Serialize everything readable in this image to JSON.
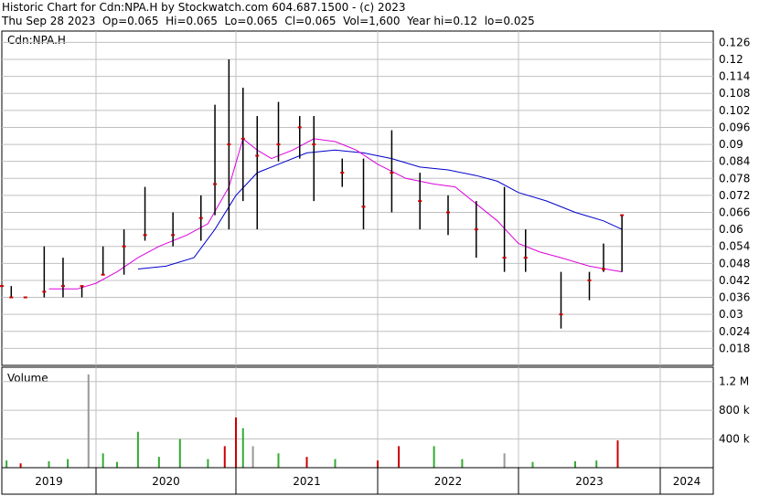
{
  "header": {
    "line1": "Historic Chart for Cdn:NPA.H by Stockwatch.com 604.687.1500 - (c) 2023",
    "line2": "Thu Sep 28 2023  Op=0.065  Hi=0.065  Lo=0.065  Cl=0.065  Vol=1,600  Year hi=0.12  lo=0.025"
  },
  "colors": {
    "price_bar": "#000000",
    "price_dot": "#cc0000",
    "ma_short": "#dd00dd",
    "ma_long": "#0000cc",
    "vol_up": "#33aa33",
    "vol_down": "#cc0000",
    "vol_neutral": "#999999",
    "grid": "#c0c0c0"
  },
  "chart_data": [
    {
      "type": "line",
      "label": "Cdn:NPA.H",
      "y_ticks": [
        "0.126",
        "0.12",
        "0.114",
        "0.108",
        "0.102",
        "0.096",
        "0.09",
        "0.084",
        "0.078",
        "0.072",
        "0.066",
        "0.06",
        "0.054",
        "0.048",
        "0.042",
        "0.036",
        "0.03",
        "0.024",
        "0.018"
      ],
      "ylim": [
        0.012,
        0.13
      ],
      "x_ticks": [
        "2019",
        "2020",
        "2021",
        "2022",
        "2023",
        "2024"
      ],
      "price_segments": [
        {
          "x": 2019.0,
          "low": 0.04,
          "high": 0.04,
          "close": 0.04
        },
        {
          "x": 2019.1,
          "low": 0.036,
          "high": 0.04,
          "close": 0.036
        },
        {
          "x": 2019.25,
          "low": 0.036,
          "high": 0.036,
          "close": 0.036
        },
        {
          "x": 2019.45,
          "low": 0.036,
          "high": 0.054,
          "close": 0.038
        },
        {
          "x": 2019.65,
          "low": 0.036,
          "high": 0.05,
          "close": 0.04
        },
        {
          "x": 2019.85,
          "low": 0.036,
          "high": 0.04,
          "close": 0.04
        },
        {
          "x": 2020.05,
          "low": 0.044,
          "high": 0.054,
          "close": 0.044
        },
        {
          "x": 2020.2,
          "low": 0.044,
          "high": 0.06,
          "close": 0.054
        },
        {
          "x": 2020.35,
          "low": 0.056,
          "high": 0.075,
          "close": 0.058
        },
        {
          "x": 2020.55,
          "low": 0.054,
          "high": 0.066,
          "close": 0.058
        },
        {
          "x": 2020.75,
          "low": 0.056,
          "high": 0.072,
          "close": 0.064
        },
        {
          "x": 2020.85,
          "low": 0.065,
          "high": 0.104,
          "close": 0.076
        },
        {
          "x": 2020.95,
          "low": 0.06,
          "high": 0.12,
          "close": 0.09
        },
        {
          "x": 2021.05,
          "low": 0.07,
          "high": 0.11,
          "close": 0.092
        },
        {
          "x": 2021.15,
          "low": 0.06,
          "high": 0.1,
          "close": 0.086
        },
        {
          "x": 2021.3,
          "low": 0.084,
          "high": 0.105,
          "close": 0.09
        },
        {
          "x": 2021.45,
          "low": 0.085,
          "high": 0.1,
          "close": 0.096
        },
        {
          "x": 2021.55,
          "low": 0.07,
          "high": 0.1,
          "close": 0.09
        },
        {
          "x": 2021.75,
          "low": 0.075,
          "high": 0.085,
          "close": 0.08
        },
        {
          "x": 2021.9,
          "low": 0.06,
          "high": 0.085,
          "close": 0.068
        },
        {
          "x": 2022.1,
          "low": 0.066,
          "high": 0.095,
          "close": 0.08
        },
        {
          "x": 2022.3,
          "low": 0.06,
          "high": 0.08,
          "close": 0.07
        },
        {
          "x": 2022.5,
          "low": 0.058,
          "high": 0.072,
          "close": 0.066
        },
        {
          "x": 2022.7,
          "low": 0.05,
          "high": 0.07,
          "close": 0.06
        },
        {
          "x": 2022.9,
          "low": 0.045,
          "high": 0.075,
          "close": 0.05
        },
        {
          "x": 2023.05,
          "low": 0.045,
          "high": 0.06,
          "close": 0.05
        },
        {
          "x": 2023.3,
          "low": 0.025,
          "high": 0.045,
          "close": 0.03
        },
        {
          "x": 2023.5,
          "low": 0.035,
          "high": 0.045,
          "close": 0.042
        },
        {
          "x": 2023.6,
          "low": 0.045,
          "high": 0.055,
          "close": 0.046
        },
        {
          "x": 2023.73,
          "low": 0.045,
          "high": 0.065,
          "close": 0.065
        }
      ],
      "ma_short": [
        {
          "x": 2019.5,
          "y": 0.039
        },
        {
          "x": 2019.8,
          "y": 0.039
        },
        {
          "x": 2020.0,
          "y": 0.041
        },
        {
          "x": 2020.15,
          "y": 0.045
        },
        {
          "x": 2020.3,
          "y": 0.05
        },
        {
          "x": 2020.45,
          "y": 0.054
        },
        {
          "x": 2020.65,
          "y": 0.058
        },
        {
          "x": 2020.8,
          "y": 0.062
        },
        {
          "x": 2020.95,
          "y": 0.075
        },
        {
          "x": 2021.05,
          "y": 0.092
        },
        {
          "x": 2021.15,
          "y": 0.088
        },
        {
          "x": 2021.25,
          "y": 0.085
        },
        {
          "x": 2021.4,
          "y": 0.088
        },
        {
          "x": 2021.55,
          "y": 0.092
        },
        {
          "x": 2021.7,
          "y": 0.091
        },
        {
          "x": 2021.85,
          "y": 0.088
        },
        {
          "x": 2022.0,
          "y": 0.083
        },
        {
          "x": 2022.2,
          "y": 0.078
        },
        {
          "x": 2022.4,
          "y": 0.076
        },
        {
          "x": 2022.55,
          "y": 0.075
        },
        {
          "x": 2022.7,
          "y": 0.069
        },
        {
          "x": 2022.85,
          "y": 0.063
        },
        {
          "x": 2023.0,
          "y": 0.055
        },
        {
          "x": 2023.15,
          "y": 0.052
        },
        {
          "x": 2023.3,
          "y": 0.05
        },
        {
          "x": 2023.5,
          "y": 0.047
        },
        {
          "x": 2023.73,
          "y": 0.045
        }
      ],
      "ma_long": [
        {
          "x": 2020.3,
          "y": 0.046
        },
        {
          "x": 2020.5,
          "y": 0.047
        },
        {
          "x": 2020.7,
          "y": 0.05
        },
        {
          "x": 2020.85,
          "y": 0.06
        },
        {
          "x": 2021.0,
          "y": 0.072
        },
        {
          "x": 2021.15,
          "y": 0.08
        },
        {
          "x": 2021.3,
          "y": 0.083
        },
        {
          "x": 2021.5,
          "y": 0.087
        },
        {
          "x": 2021.7,
          "y": 0.088
        },
        {
          "x": 2021.9,
          "y": 0.087
        },
        {
          "x": 2022.1,
          "y": 0.085
        },
        {
          "x": 2022.3,
          "y": 0.082
        },
        {
          "x": 2022.5,
          "y": 0.081
        },
        {
          "x": 2022.7,
          "y": 0.079
        },
        {
          "x": 2022.85,
          "y": 0.077
        },
        {
          "x": 2023.0,
          "y": 0.073
        },
        {
          "x": 2023.2,
          "y": 0.07
        },
        {
          "x": 2023.4,
          "y": 0.066
        },
        {
          "x": 2023.6,
          "y": 0.063
        },
        {
          "x": 2023.73,
          "y": 0.06
        }
      ]
    },
    {
      "type": "bar",
      "label": "Volume",
      "y_ticks": [
        "1.2 M",
        "800 k",
        "400 k"
      ],
      "ylim": [
        0,
        1400000
      ],
      "bars": [
        {
          "x": 2019.05,
          "v": 100000,
          "c": "up"
        },
        {
          "x": 2019.2,
          "v": 60000,
          "c": "down"
        },
        {
          "x": 2019.5,
          "v": 90000,
          "c": "up"
        },
        {
          "x": 2019.7,
          "v": 120000,
          "c": "up"
        },
        {
          "x": 2019.92,
          "v": 1300000,
          "c": "neutral"
        },
        {
          "x": 2020.05,
          "v": 200000,
          "c": "up"
        },
        {
          "x": 2020.15,
          "v": 80000,
          "c": "up"
        },
        {
          "x": 2020.3,
          "v": 500000,
          "c": "up"
        },
        {
          "x": 2020.45,
          "v": 150000,
          "c": "up"
        },
        {
          "x": 2020.6,
          "v": 400000,
          "c": "up"
        },
        {
          "x": 2020.8,
          "v": 120000,
          "c": "up"
        },
        {
          "x": 2020.92,
          "v": 300000,
          "c": "down"
        },
        {
          "x": 2021.0,
          "v": 700000,
          "c": "down"
        },
        {
          "x": 2021.05,
          "v": 550000,
          "c": "up"
        },
        {
          "x": 2021.12,
          "v": 300000,
          "c": "neutral"
        },
        {
          "x": 2021.3,
          "v": 200000,
          "c": "up"
        },
        {
          "x": 2021.5,
          "v": 150000,
          "c": "down"
        },
        {
          "x": 2021.7,
          "v": 120000,
          "c": "up"
        },
        {
          "x": 2022.0,
          "v": 100000,
          "c": "down"
        },
        {
          "x": 2022.15,
          "v": 300000,
          "c": "down"
        },
        {
          "x": 2022.4,
          "v": 300000,
          "c": "up"
        },
        {
          "x": 2022.6,
          "v": 120000,
          "c": "up"
        },
        {
          "x": 2022.9,
          "v": 200000,
          "c": "neutral"
        },
        {
          "x": 2023.1,
          "v": 80000,
          "c": "up"
        },
        {
          "x": 2023.4,
          "v": 90000,
          "c": "up"
        },
        {
          "x": 2023.55,
          "v": 100000,
          "c": "up"
        },
        {
          "x": 2023.7,
          "v": 380000,
          "c": "down"
        }
      ]
    }
  ]
}
